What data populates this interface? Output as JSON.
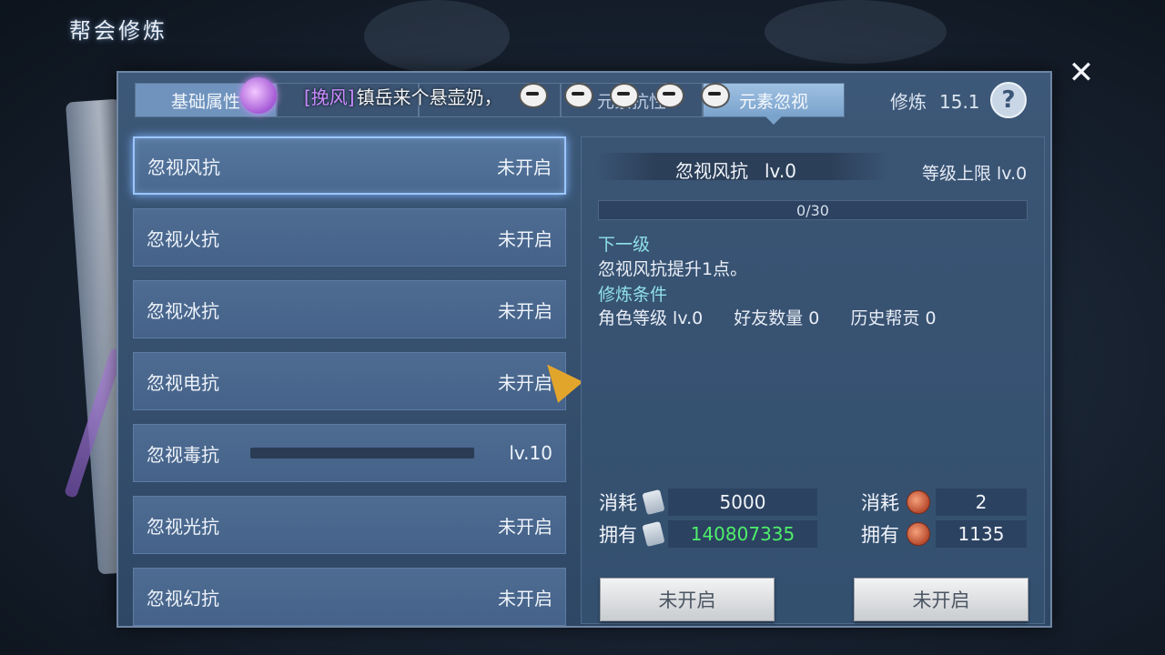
{
  "page_title": "帮会修炼",
  "tabs": [
    {
      "label": "基础属性",
      "active": false
    },
    {
      "label": "",
      "active": false
    },
    {
      "label": "",
      "active": false
    },
    {
      "label": "元素抗性",
      "active": false
    },
    {
      "label": "元素忽视",
      "active": true
    }
  ],
  "practice": {
    "label": "修炼",
    "value": "15.1"
  },
  "broadcast": {
    "name": "[挽风]",
    "message": "镇岳来个悬壶奶，"
  },
  "list": [
    {
      "name": "忽视风抗",
      "status": "未开启"
    },
    {
      "name": "忽视火抗",
      "status": "未开启"
    },
    {
      "name": "忽视冰抗",
      "status": "未开启"
    },
    {
      "name": "忽视电抗",
      "status": "未开启"
    },
    {
      "name": "忽视毒抗",
      "level": "lv.10"
    },
    {
      "name": "忽视光抗",
      "status": "未开启"
    },
    {
      "name": "忽视幻抗",
      "status": "未开启"
    }
  ],
  "detail": {
    "name": "忽视风抗",
    "level": "lv.0",
    "level_cap_label": "等级上限",
    "level_cap": "lv.0",
    "progress": "0/30",
    "next_label": "下一级",
    "next_desc": "忽视风抗提升1点。",
    "cond_label": "修炼条件",
    "conditions": [
      "角色等级 lv.0",
      "好友数量 0",
      "历史帮贡 0"
    ]
  },
  "costs": {
    "left": {
      "cost_label": "消耗",
      "cost": "5000",
      "own_label": "拥有",
      "own": "140807335"
    },
    "right": {
      "cost_label": "消耗",
      "cost": "2",
      "own_label": "拥有",
      "own": "1135"
    }
  },
  "buttons": {
    "left": "未开启",
    "right": "未开启"
  }
}
